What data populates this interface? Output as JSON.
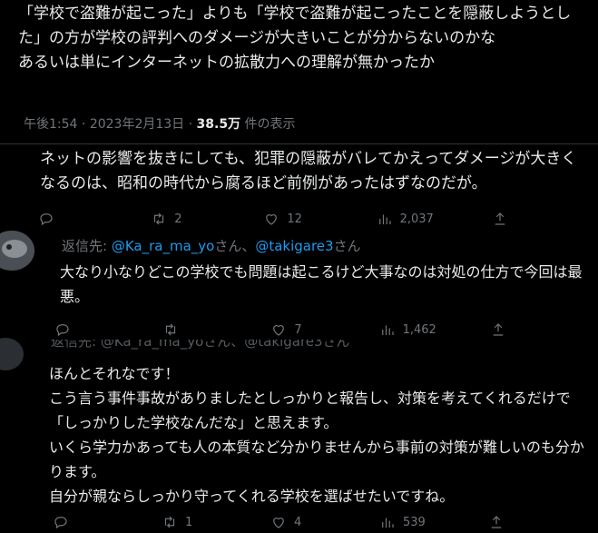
{
  "main_tweet": {
    "text": "「学校で盗難が起こった」よりも「学校で盗難が起こったことを隠蔽しようとした」の方が学校の評判へのダメージが大きいことが分からないのかな\nあるいは単にインターネットの拡散力への理解が無かったか",
    "time": "午後1:54",
    "dot": "·",
    "date": "2023年2月13日",
    "views": "38.5万",
    "views_label": "件の表示"
  },
  "replies": [
    {
      "text": "ネットの影響を抜きにしても、犯罪の隠蔽がバレてかえってダメージが大きくなるのは、昭和の時代から腐るほど前例があったはずなのだが。",
      "retweets": "2",
      "likes": "12",
      "views": "2,037"
    },
    {
      "replyto_prefix": "返信先: ",
      "replyto_user1": "@Ka_ra_ma_yo",
      "replyto_mid": "さん、",
      "replyto_user2": "@takigare3",
      "replyto_suffix": "さん",
      "text": "大なり小なりどこの学校でも問題は起こるけど大事なのは対処の仕方で今回は最悪。",
      "retweets": "",
      "likes": "7",
      "views": "1,462"
    },
    {
      "replyto_partial": "返信先: @Ka_ra_ma_yoさん、@takigare3さん",
      "text": "ほんとそれなです！\nこう言う事件事故がありましたとしっかりと報告し、対策を考えてくれるだけで「しっかりした学校なんだな」と思えます。\nいくら学力かあっても人の本質など分かりませんから事前の対策が難しいのも分かります。\n自分が親ならしっかり守ってくれる学校を選ばせたいですね。",
      "retweets": "1",
      "likes": "4",
      "views": "539"
    }
  ]
}
